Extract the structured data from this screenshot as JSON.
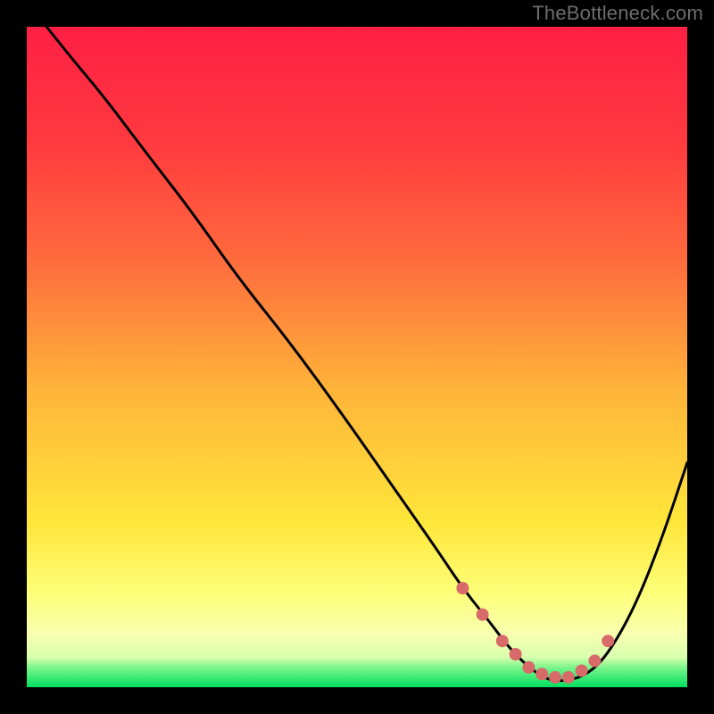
{
  "watermark": "TheBottleneck.com",
  "colors": {
    "bg": "#000000",
    "gradient_top": "#ff1f44",
    "gradient_mid_upper": "#ff6a3d",
    "gradient_mid": "#ffb43a",
    "gradient_mid_lower": "#ffe63a",
    "gradient_low": "#fdff7a",
    "gradient_band": "#f7ffb0",
    "gradient_bottom": "#00e060",
    "curve": "#000000",
    "dots": "#d96a6a"
  },
  "chart_data": {
    "type": "line",
    "title": "",
    "xlabel": "",
    "ylabel": "",
    "xlim": [
      0,
      100
    ],
    "ylim": [
      0,
      100
    ],
    "series": [
      {
        "name": "bottleneck-curve",
        "x": [
          3,
          7,
          12,
          18,
          25,
          32,
          40,
          48,
          55,
          62,
          66,
          70,
          73,
          76,
          79,
          82,
          85,
          88,
          92,
          96,
          100
        ],
        "y": [
          100,
          95,
          89,
          81,
          72,
          62,
          52,
          41,
          31,
          21,
          15,
          10,
          6,
          3,
          1,
          1,
          2,
          5,
          12,
          22,
          34
        ]
      }
    ],
    "markers": {
      "name": "optimal-range-dots",
      "x": [
        66,
        69,
        72,
        74,
        76,
        78,
        80,
        82,
        84,
        86,
        88
      ],
      "y": [
        15,
        11,
        7,
        5,
        3,
        2,
        1.5,
        1.5,
        2.5,
        4,
        7
      ]
    }
  }
}
